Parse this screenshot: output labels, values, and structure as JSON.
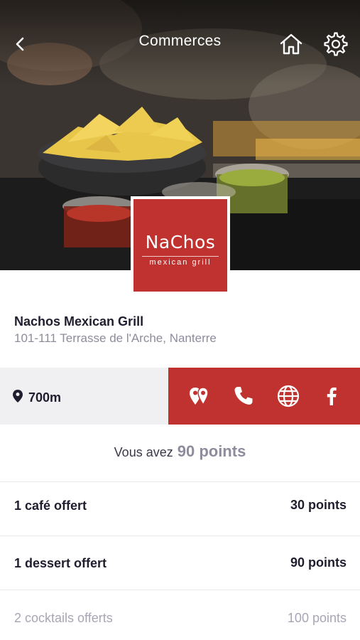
{
  "header": {
    "title": "Commerces",
    "back_icon": "chevron-left-icon",
    "home_icon": "home-icon",
    "settings_icon": "gear-icon"
  },
  "logo": {
    "word": "NaChos",
    "subtitle": "mexican grill",
    "color": "#c0322f"
  },
  "shop": {
    "name": "Nachos Mexican Grill",
    "address": "101-111 Terrasse de l'Arche, Nanterre"
  },
  "location": {
    "icon": "map-pin-icon",
    "distance": "700m"
  },
  "actions": [
    {
      "name": "directions",
      "icon": "map-markers-icon"
    },
    {
      "name": "call",
      "icon": "phone-icon"
    },
    {
      "name": "website",
      "icon": "globe-icon"
    },
    {
      "name": "facebook",
      "icon": "facebook-icon"
    }
  ],
  "points": {
    "prefix": "Vous avez",
    "value": "90 points"
  },
  "rewards": [
    {
      "label": "1 café offert",
      "points": "30 points",
      "available": true
    },
    {
      "label": "1 dessert offert",
      "points": "90 points",
      "available": true
    },
    {
      "label": "2 cocktails offerts",
      "points": "100 points",
      "available": false
    }
  ],
  "colors": {
    "accent": "#c0322f",
    "text": "#1f1d2e",
    "muted": "#8e8c9c",
    "panel": "#f0f0f2"
  }
}
